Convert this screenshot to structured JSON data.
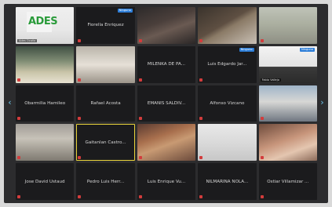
{
  "meeting": {
    "tiles": [
      {
        "type": "video",
        "label": "",
        "tag": "Ades Ocaña",
        "badge": "",
        "logo_text": "ADES"
      },
      {
        "type": "name",
        "label": "Fiorella Enriquez",
        "badge": "Ninguno"
      },
      {
        "type": "video",
        "label": "",
        "tag": "",
        "badge": ""
      },
      {
        "type": "video",
        "label": "",
        "tag": "",
        "badge": ""
      },
      {
        "type": "video",
        "label": "",
        "tag": "",
        "badge": ""
      },
      {
        "type": "video",
        "label": "",
        "tag": "",
        "badge": ""
      },
      {
        "type": "video",
        "label": "",
        "tag": "",
        "badge": ""
      },
      {
        "type": "name",
        "label": "MILENKA DE PA...",
        "badge": ""
      },
      {
        "type": "name",
        "label": "Luis Edgardo Jar...",
        "badge": "Ninguno"
      },
      {
        "type": "video",
        "label": "",
        "tag": "Fabio Vallejo",
        "badge": "Ninguno"
      },
      {
        "type": "name",
        "label": "Obarmilia Hamileo",
        "badge": ""
      },
      {
        "type": "name",
        "label": "Rafael Acosta",
        "badge": ""
      },
      {
        "type": "name",
        "label": "EMANIS SALDIV...",
        "badge": ""
      },
      {
        "type": "name",
        "label": "Alfonso Vizcano",
        "badge": ""
      },
      {
        "type": "video",
        "label": "",
        "tag": "",
        "badge": ""
      },
      {
        "type": "video",
        "label": "",
        "tag": "",
        "badge": ""
      },
      {
        "type": "name",
        "label": "Gaitanlan Castro...",
        "badge": "",
        "active": true
      },
      {
        "type": "video",
        "label": "",
        "tag": "",
        "badge": ""
      },
      {
        "type": "video",
        "label": "",
        "tag": "",
        "badge": ""
      },
      {
        "type": "video",
        "label": "",
        "tag": "",
        "badge": ""
      },
      {
        "type": "name",
        "label": "Jose David Ustaud",
        "badge": ""
      },
      {
        "type": "name",
        "label": "Pedro Luis Herr...",
        "badge": ""
      },
      {
        "type": "name",
        "label": "Luis Enrique Vu...",
        "badge": ""
      },
      {
        "type": "name",
        "label": "NILMARINA NOLA...",
        "badge": ""
      },
      {
        "type": "name",
        "label": "Ostiar Villamizar ...",
        "badge": ""
      }
    ],
    "nav_left": "‹",
    "nav_right": "›"
  },
  "colors": {
    "background": "#2c2c2e",
    "tile": "#1b1b1d",
    "active_border": "#e8d23a",
    "badge": "#2d7ed8",
    "mic_muted": "#d23c3c",
    "nav": "#6cc7ee"
  }
}
